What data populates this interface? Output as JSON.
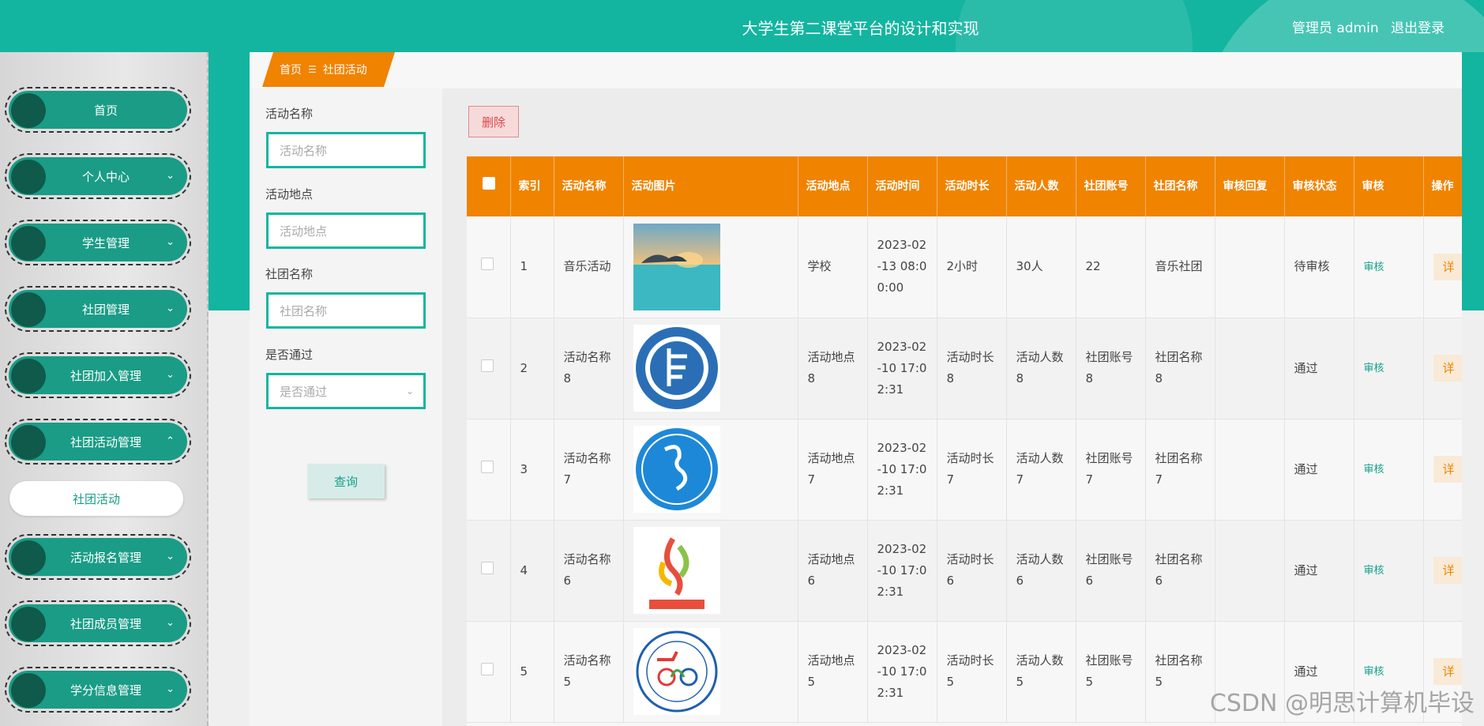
{
  "header": {
    "title": "大学生第二课堂平台的设计和实现",
    "user_label": "管理员 admin",
    "logout": "退出登录"
  },
  "sidebar": {
    "items": [
      {
        "label": "首页",
        "expandable": false
      },
      {
        "label": "个人中心",
        "expandable": true
      },
      {
        "label": "学生管理",
        "expandable": true
      },
      {
        "label": "社团管理",
        "expandable": true
      },
      {
        "label": "社团加入管理",
        "expandable": true
      },
      {
        "label": "社团活动管理",
        "expandable": true,
        "expanded": true
      },
      {
        "label": "活动报名管理",
        "expandable": true
      },
      {
        "label": "社团成员管理",
        "expandable": true
      },
      {
        "label": "学分信息管理",
        "expandable": true
      }
    ],
    "active_sub": "社团活动"
  },
  "breadcrumb": {
    "home": "首页",
    "sep": "☰",
    "current": "社团活动"
  },
  "search": {
    "fields": [
      {
        "label": "活动名称",
        "placeholder": "活动名称"
      },
      {
        "label": "活动地点",
        "placeholder": "活动地点"
      },
      {
        "label": "社团名称",
        "placeholder": "社团名称"
      },
      {
        "label": "是否通过",
        "placeholder": "是否通过"
      }
    ],
    "query_button": "查询"
  },
  "toolbar": {
    "delete_button": "删除"
  },
  "table": {
    "headers": [
      "索引",
      "活动名称",
      "活动图片",
      "活动地点",
      "活动时间",
      "活动时长",
      "活动人数",
      "社团账号",
      "社团名称",
      "审核回复",
      "审核状态",
      "审核",
      "操作"
    ],
    "rows": [
      {
        "index": "1",
        "name": "音乐活动",
        "place": "学校",
        "time": "2023-02-13 08:00:00",
        "duration": "2小时",
        "people": "30人",
        "account": "22",
        "club": "音乐社团",
        "reply": "",
        "status": "待审核",
        "audit": "审核",
        "op": "详"
      },
      {
        "index": "2",
        "name": "活动名称8",
        "place": "活动地点8",
        "time": "2023-02-10 17:02:31",
        "duration": "活动时长8",
        "people": "活动人数8",
        "account": "社团账号8",
        "club": "社团名称8",
        "reply": "",
        "status": "通过",
        "audit": "审核",
        "op": "详"
      },
      {
        "index": "3",
        "name": "活动名称7",
        "place": "活动地点7",
        "time": "2023-02-10 17:02:31",
        "duration": "活动时长7",
        "people": "活动人数7",
        "account": "社团账号7",
        "club": "社团名称7",
        "reply": "",
        "status": "通过",
        "audit": "审核",
        "op": "详"
      },
      {
        "index": "4",
        "name": "活动名称6",
        "place": "活动地点6",
        "time": "2023-02-10 17:02:31",
        "duration": "活动时长6",
        "people": "活动人数6",
        "account": "社团账号6",
        "club": "社团名称6",
        "reply": "",
        "status": "通过",
        "audit": "审核",
        "op": "详"
      },
      {
        "index": "5",
        "name": "活动名称5",
        "place": "活动地点5",
        "time": "2023-02-10 17:02:31",
        "duration": "活动时长5",
        "people": "活动人数5",
        "account": "社团账号5",
        "club": "社团名称5",
        "reply": "",
        "status": "通过",
        "audit": "审核",
        "op": "详"
      }
    ]
  },
  "watermark": "CSDN @明思计算机毕设",
  "colors": {
    "primary": "#13b5a0",
    "accent": "#f08300",
    "menu": "#1a9c86"
  }
}
